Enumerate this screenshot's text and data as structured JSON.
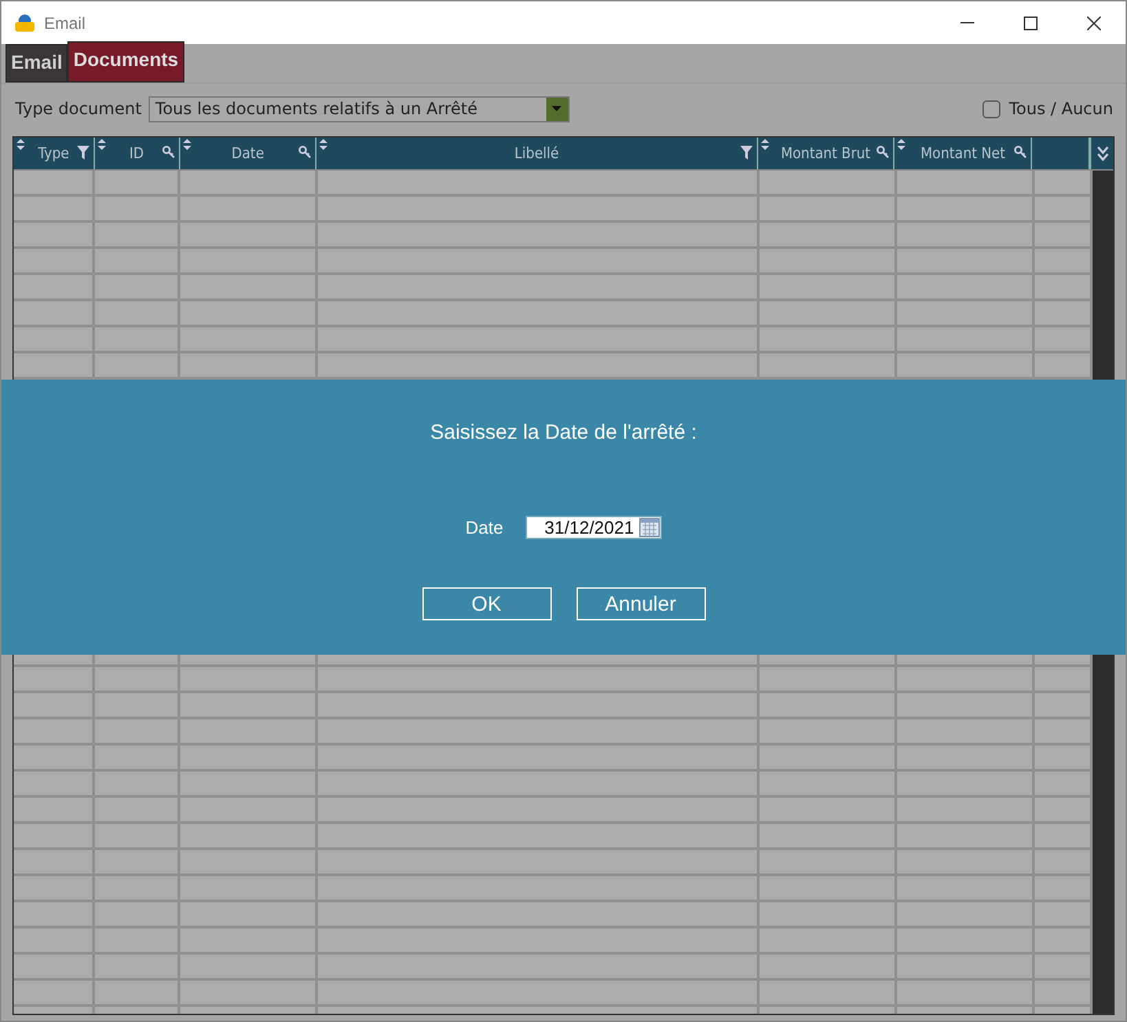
{
  "window": {
    "title": "Email"
  },
  "tabs": [
    {
      "label": "Email",
      "selected": false
    },
    {
      "label": "Documents",
      "selected": true
    }
  ],
  "filter": {
    "label": "Type document",
    "value": "Tous les documents relatifs à un Arrêté"
  },
  "select_all": {
    "label": "Tous / Aucun",
    "checked": false
  },
  "table": {
    "columns": [
      {
        "label": "Type",
        "kind": "filter"
      },
      {
        "label": "ID",
        "kind": "key"
      },
      {
        "label": "Date",
        "kind": "key"
      },
      {
        "label": "Libellé",
        "kind": "filter"
      },
      {
        "label": "Montant Brut",
        "kind": "key"
      },
      {
        "label": "Montant Net",
        "kind": "key"
      }
    ]
  },
  "dialog": {
    "prompt": "Saisissez la Date de l'arrêté :",
    "date_label": "Date",
    "date_value": "31/12/2021",
    "buttons": [
      "OK",
      "Annuler"
    ]
  }
}
